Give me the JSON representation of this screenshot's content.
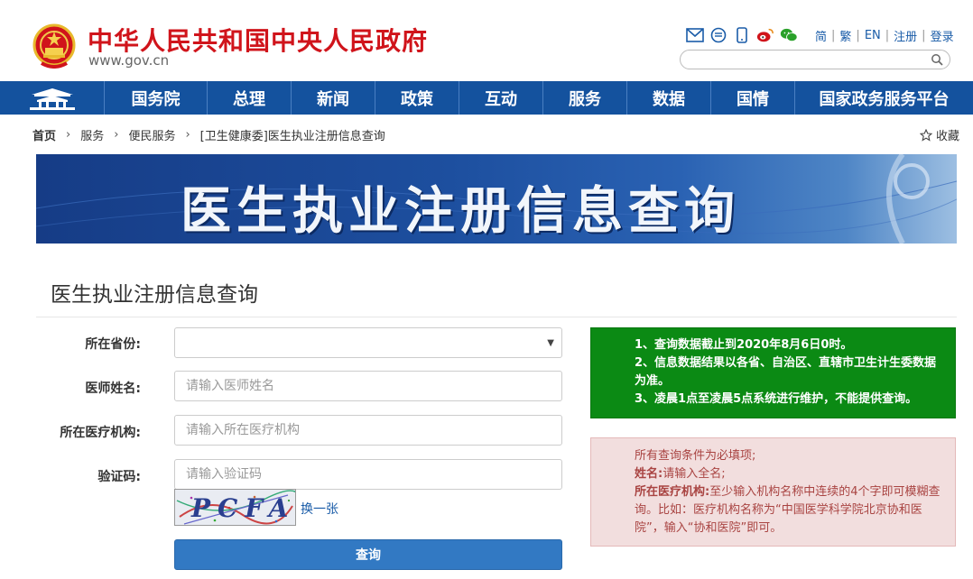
{
  "header": {
    "site_title": "中华人民共和国中央人民政府",
    "site_url": "www.gov.cn",
    "tools": [
      "mail-icon",
      "news-icon",
      "mobile-icon",
      "weibo-icon",
      "wechat-icon"
    ],
    "lang_links": [
      "简",
      "繁",
      "EN",
      "注册",
      "登录"
    ],
    "search_placeholder": ""
  },
  "nav": {
    "items": [
      "国务院",
      "总理",
      "新闻",
      "政策",
      "互动",
      "服务",
      "数据",
      "国情",
      "国家政务服务平台"
    ]
  },
  "breadcrumb": {
    "items": [
      "首页",
      "服务",
      "便民服务",
      "[卫生健康委]医生执业注册信息查询"
    ],
    "favorite_label": "收藏"
  },
  "banner": {
    "title": "医生执业注册信息查询"
  },
  "page_title": "医生执业注册信息查询",
  "form": {
    "province_label": "所在省份:",
    "province_value": "",
    "name_label": "医师姓名:",
    "name_placeholder": "请输入医师姓名",
    "org_label": "所在医疗机构:",
    "org_placeholder": "请输入所在医疗机构",
    "captcha_label": "验证码:",
    "captcha_placeholder": "请输入验证码",
    "captcha_text": "PCFA",
    "captcha_refresh": "换一张",
    "submit_label": "查询"
  },
  "notice": {
    "green_lines": [
      "1、查询数据截止到2020年8月6日0时。",
      "2、信息数据结果以各省、自治区、直辖市卫生计生委数据为准。",
      "3、凌晨1点至凌晨5点系统进行维护，不能提供查询。"
    ],
    "red_intro": "所有查询条件为必填项;",
    "red_name_key": "姓名:",
    "red_name_value": "请输入全名;",
    "red_org_key": "所在医疗机构:",
    "red_org_value": "至少输入机构名称中连续的4个字即可模糊查询。比如：医疗机构名称为“中国医学科学院北京协和医院”，输入“协和医院”即可。"
  },
  "colors": {
    "brand_red": "#d0141b",
    "nav_blue": "#14529e",
    "button_blue": "#3279c3",
    "notice_green": "#0b8a14",
    "notice_red_bg": "#f2dede",
    "notice_red_text": "#a94442"
  }
}
